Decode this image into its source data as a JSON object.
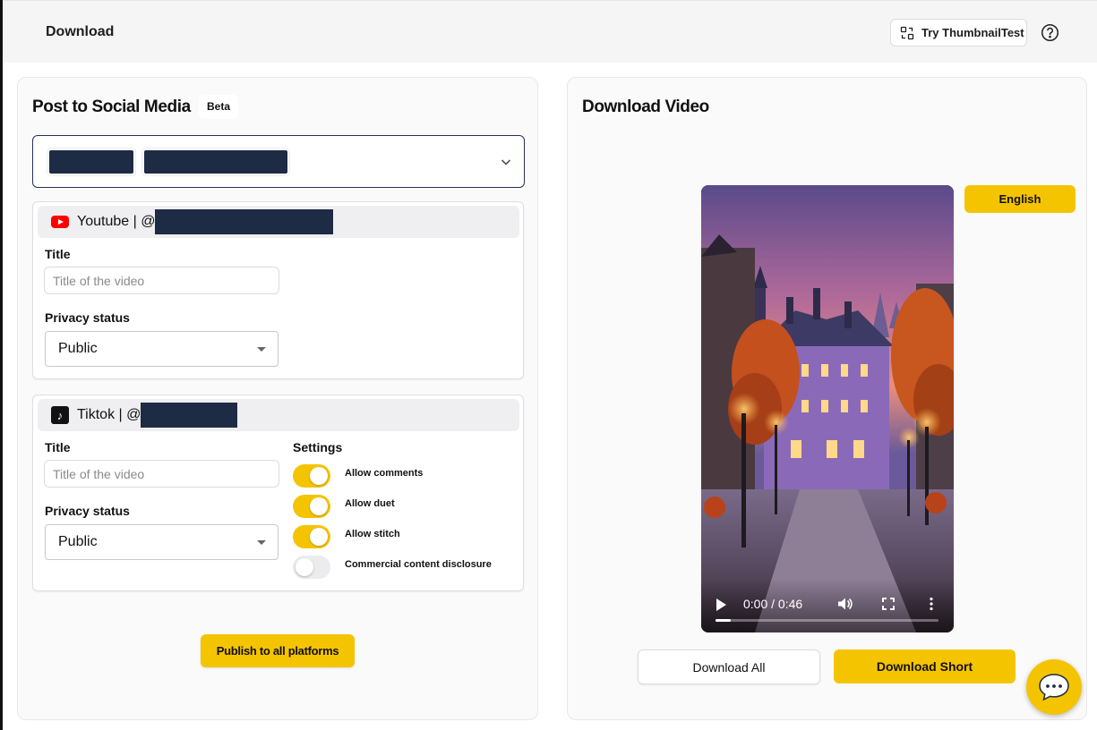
{
  "header": {
    "title": "Download",
    "try_button_label": "Try ThumbnailTest",
    "help_icon": "question-circle-icon"
  },
  "post_panel": {
    "title": "Post to Social Media",
    "badge": "Beta",
    "account_select_icon": "chevron-down-icon",
    "youtube": {
      "platform_label": "Youtube | @",
      "title_label": "Title",
      "title_placeholder": "Title of the video",
      "privacy_label": "Privacy status",
      "privacy_value": "Public"
    },
    "tiktok": {
      "platform_label": "Tiktok | @",
      "title_label": "Title",
      "title_placeholder": "Title of the video",
      "privacy_label": "Privacy status",
      "privacy_value": "Public",
      "settings_label": "Settings",
      "settings": [
        {
          "label": "Allow comments",
          "on": true
        },
        {
          "label": "Allow duet",
          "on": true
        },
        {
          "label": "Allow stitch",
          "on": true
        },
        {
          "label": "Commercial content disclosure",
          "on": false
        }
      ]
    },
    "publish_button": "Publish to all platforms"
  },
  "download_panel": {
    "title": "Download Video",
    "language_button": "English",
    "video": {
      "time": "0:00 / 0:46",
      "progress_fraction": 0.07
    },
    "download_all_button": "Download All",
    "download_short_button": "Download Short"
  },
  "colors": {
    "accent": "#f5c400",
    "redaction": "#1e2b45",
    "youtube_red": "#ff0000"
  },
  "chat": {
    "icon": "chat-bubble-icon"
  }
}
